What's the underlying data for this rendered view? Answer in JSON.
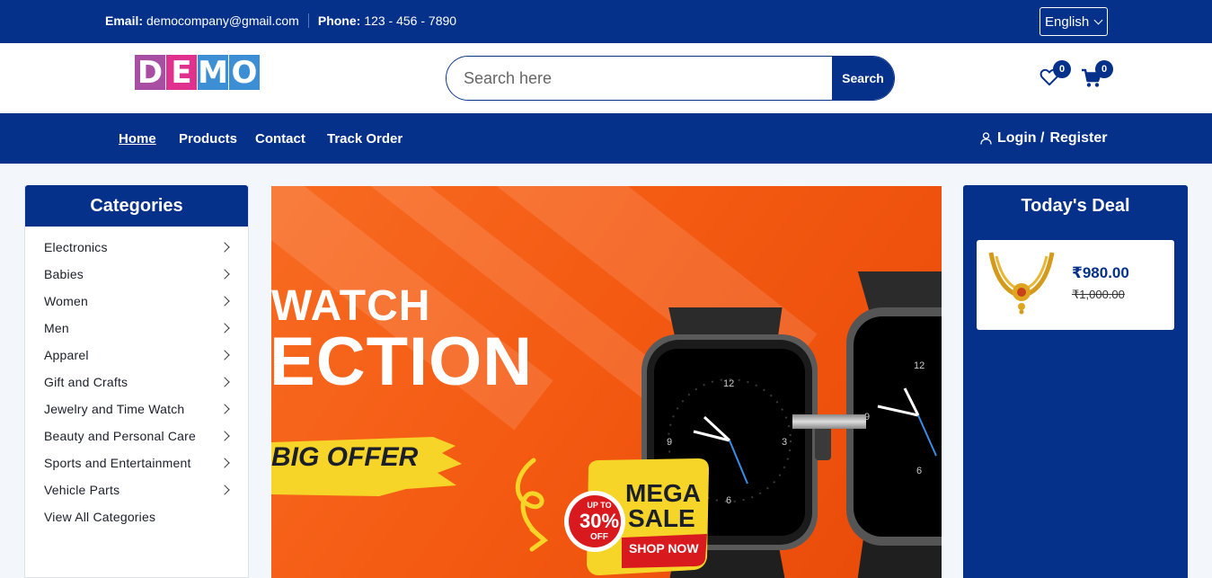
{
  "topbar": {
    "email_label": "Email:",
    "email_value": "democompany@gmail.com",
    "phone_label": "Phone:",
    "phone_value": "123 - 456 - 7890",
    "language": "English"
  },
  "header": {
    "logo_letters": [
      "D",
      "E",
      "M",
      "O"
    ],
    "logo_colors": [
      "#a84ea3",
      "#e0318f",
      "#3c8fd4",
      "#3c8fd4"
    ],
    "search_placeholder": "Search here",
    "search_button": "Search",
    "wishlist_count": "0",
    "cart_count": "0"
  },
  "nav": {
    "items": [
      "Home",
      "Products",
      "Contact",
      "Track Order"
    ],
    "active": "Home",
    "login": "Login /",
    "register": "Register"
  },
  "categories": {
    "title": "Categories",
    "items": [
      "Electronics",
      "Babies",
      "Women",
      "Men",
      "Apparel",
      "Gift and Crafts",
      "Jewelry and Time Watch",
      "Beauty and Personal Care",
      "Sports and Entertainment",
      "Vehicle Parts"
    ],
    "view_all": "View All Categories"
  },
  "banner": {
    "line1": "WATCH",
    "line2": "ECTION",
    "offer": "BIG OFFER",
    "badge_top": "UP TO",
    "badge_pct": "30%",
    "badge_off": "OFF",
    "mega": "MEGA",
    "sale": "SALE",
    "shop_now": "SHOP NOW"
  },
  "deal": {
    "title": "Today's Deal",
    "price": "₹980.00",
    "old_price": "₹1,000.00"
  },
  "colors": {
    "primary": "#05318a",
    "banner_orange": "#f45a12",
    "sale_yellow": "#f7d528",
    "sale_red": "#d81a1f"
  }
}
